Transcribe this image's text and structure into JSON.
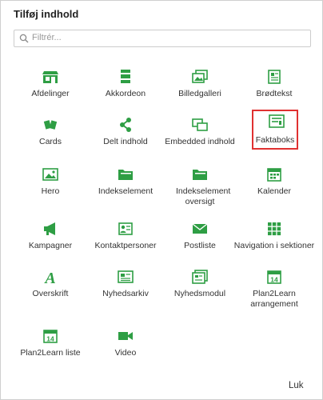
{
  "dialog": {
    "title": "Tilføj indhold",
    "search_placeholder": "Filtrér...",
    "close_label": "Luk",
    "accent_color": "#2e9e44",
    "selected_outline_color": "#e03131",
    "selected_item": "Faktaboks"
  },
  "items": [
    {
      "label": "Afdelinger",
      "icon": "storefront-icon"
    },
    {
      "label": "Akkordeon",
      "icon": "accordion-icon"
    },
    {
      "label": "Billedgalleri",
      "icon": "gallery-icon"
    },
    {
      "label": "Brødtekst",
      "icon": "text-document-icon"
    },
    {
      "label": "Cards",
      "icon": "cards-icon"
    },
    {
      "label": "Delt indhold",
      "icon": "share-icon"
    },
    {
      "label": "Embedded indhold",
      "icon": "embed-icon"
    },
    {
      "label": "Faktaboks",
      "icon": "factbox-icon"
    },
    {
      "label": "Hero",
      "icon": "image-icon"
    },
    {
      "label": "Indekselement",
      "icon": "folder-icon"
    },
    {
      "label": "Indekselement oversigt",
      "icon": "folder-icon"
    },
    {
      "label": "Kalender",
      "icon": "calendar-icon"
    },
    {
      "label": "Kampagner",
      "icon": "megaphone-icon"
    },
    {
      "label": "Kontaktpersoner",
      "icon": "contacts-icon"
    },
    {
      "label": "Postliste",
      "icon": "envelope-icon"
    },
    {
      "label": "Navigation i sektioner",
      "icon": "grid-icon"
    },
    {
      "label": "Overskrift",
      "icon": "heading-letter-icon"
    },
    {
      "label": "Nyhedsarkiv",
      "icon": "newspaper-icon"
    },
    {
      "label": "Nyhedsmodul",
      "icon": "news-module-icon"
    },
    {
      "label": "Plan2Learn arrangement",
      "icon": "calendar-14-icon"
    },
    {
      "label": "Plan2Learn liste",
      "icon": "calendar-14-icon"
    },
    {
      "label": "Video",
      "icon": "video-camera-icon"
    }
  ]
}
